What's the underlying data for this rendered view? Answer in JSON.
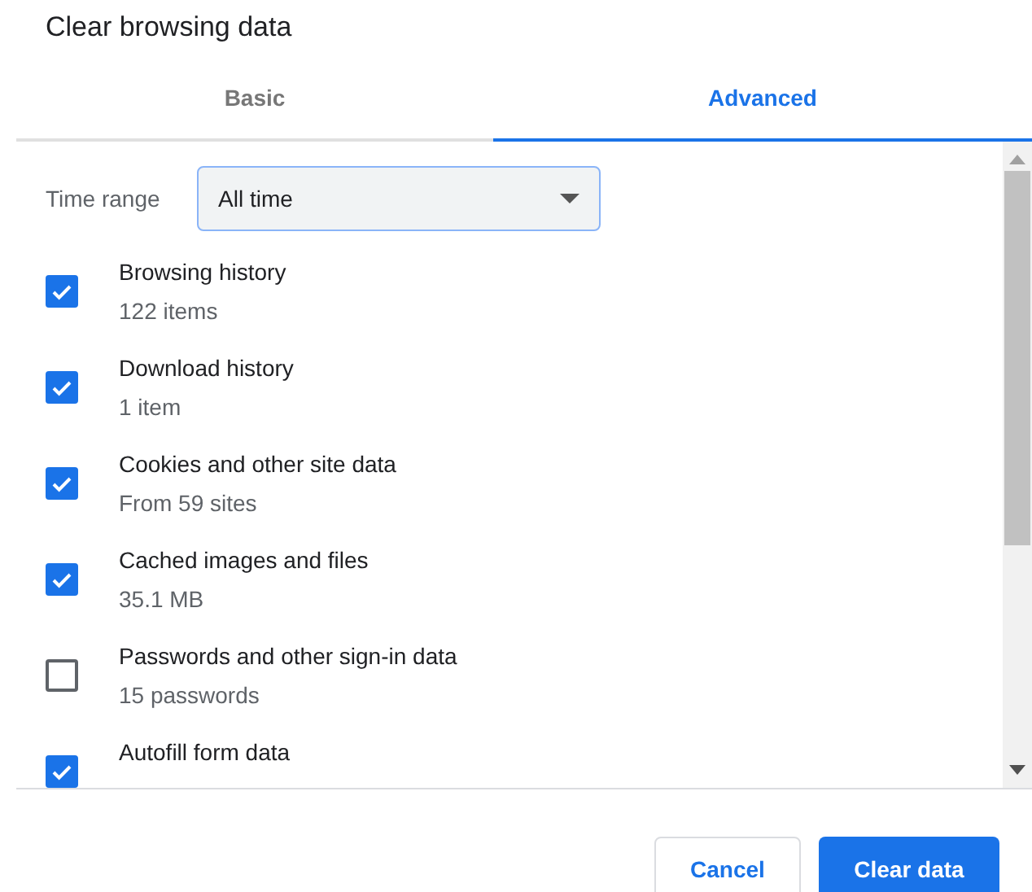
{
  "dialog": {
    "title": "Clear browsing data"
  },
  "tabs": [
    {
      "label": "Basic",
      "selected": false
    },
    {
      "label": "Advanced",
      "selected": true
    }
  ],
  "time_range": {
    "label": "Time range",
    "value": "All time"
  },
  "options": [
    {
      "label": "Browsing history",
      "detail": "122 items",
      "checked": true
    },
    {
      "label": "Download history",
      "detail": "1 item",
      "checked": true
    },
    {
      "label": "Cookies and other site data",
      "detail": "From 59 sites",
      "checked": true
    },
    {
      "label": "Cached images and files",
      "detail": "35.1 MB",
      "checked": true
    },
    {
      "label": "Passwords and other sign-in data",
      "detail": "15 passwords",
      "checked": false
    },
    {
      "label": "Autofill form data",
      "checked": true
    }
  ],
  "buttons": [
    {
      "label": "Cancel",
      "kind": "secondary"
    },
    {
      "label": "Clear data",
      "kind": "primary"
    }
  ]
}
